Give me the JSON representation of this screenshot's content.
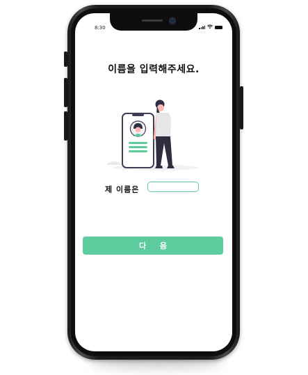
{
  "status_bar": {
    "time": "8:30"
  },
  "title": "이름을 입력해주세요.",
  "illustration": {
    "icon": "person-with-phone-profile-illustration"
  },
  "name_field": {
    "label": "제 이름은",
    "value": "",
    "placeholder": ""
  },
  "next_button": {
    "label": "다 음"
  },
  "colors": {
    "accent": "#5ccc9e",
    "frame": "#1c1c1c",
    "text": "#111111"
  }
}
